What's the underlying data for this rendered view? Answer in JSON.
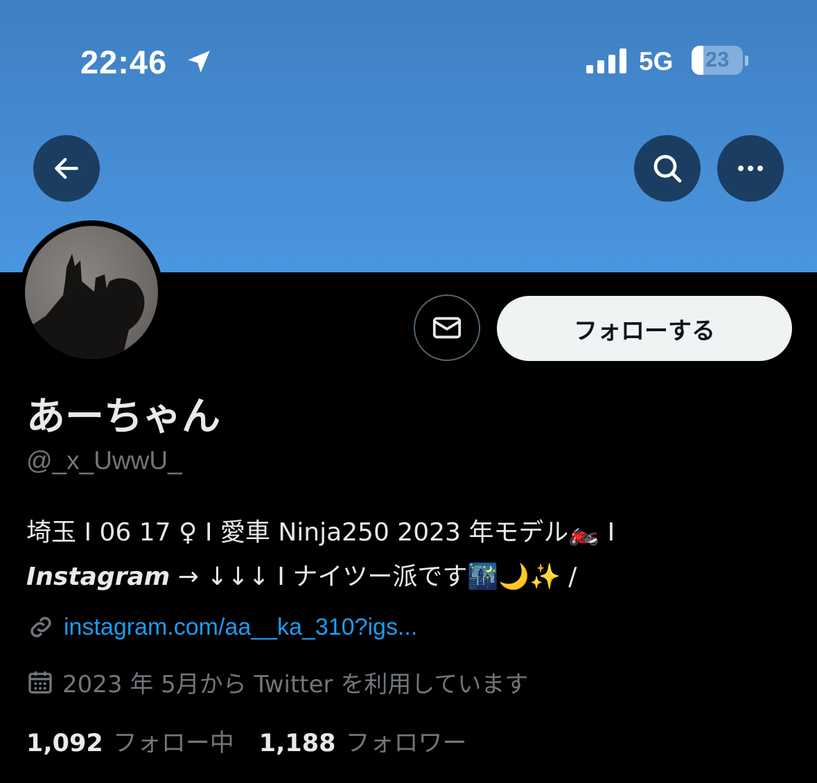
{
  "status_bar": {
    "time": "22:46",
    "network": "5G",
    "battery_level": "23",
    "battery_percent": 23,
    "icons": [
      "location-arrow-icon",
      "cellular-signal-icon",
      "battery-icon"
    ]
  },
  "nav": {
    "back_icon": "arrow-left-icon",
    "search_icon": "search-icon",
    "more_icon": "more-horizontal-icon"
  },
  "profile": {
    "display_name": "あーちゃん",
    "handle": "@_x_UwwU_",
    "bio_line1": "埼玉 I 06 17 ♀ I 愛車 Ninja250 2023 年モデル🏍️ I",
    "bio_insta": "Instagram",
    "bio_line2_rest": " → ↓↓↓ I ナイツー派です🌃🌙✨ /",
    "link": "instagram.com/aa__ka_310?igs...",
    "joined": "2023 年 5月から Twitter を利用しています"
  },
  "actions": {
    "message_icon": "envelope-icon",
    "follow_label": "フォローする"
  },
  "stats": {
    "following_count": "1,092",
    "following_label": "フォロー中",
    "followers_count": "1,188",
    "followers_label": "フォロワー"
  },
  "colors": {
    "banner": "#4a96e0",
    "link": "#1d9bf0",
    "muted": "#71767b",
    "follow_button_bg": "#eff3f4"
  }
}
